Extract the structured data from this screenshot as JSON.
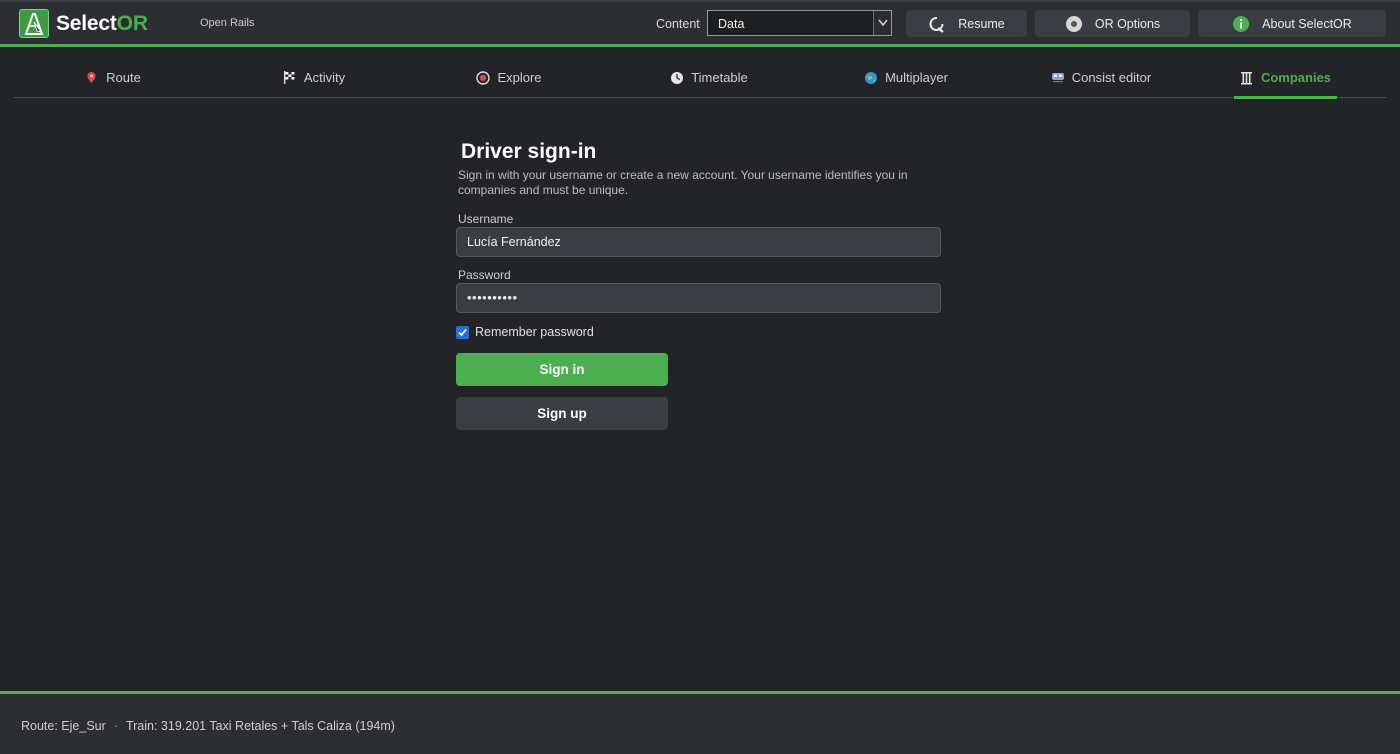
{
  "app": {
    "name_part1": "Select",
    "name_part2": "OR",
    "subtitle": "Open Rails"
  },
  "toolbar": {
    "content_label": "Content",
    "content_value": "Data",
    "resume_label": "Resume",
    "options_label": "OR Options",
    "about_label": "About SelectOR"
  },
  "tabs": [
    {
      "label": "Route",
      "icon": "map-pin-icon"
    },
    {
      "label": "Activity",
      "icon": "checkered-flag-icon"
    },
    {
      "label": "Explore",
      "icon": "explore-icon"
    },
    {
      "label": "Timetable",
      "icon": "clock-icon"
    },
    {
      "label": "Multiplayer",
      "icon": "globe-icon"
    },
    {
      "label": "Consist editor",
      "icon": "train-icon"
    },
    {
      "label": "Companies",
      "icon": "building-icon",
      "active": true
    }
  ],
  "signin": {
    "title": "Driver sign-in",
    "description": "Sign in with your username or create a new account. Your username identifies you in companies and must be unique.",
    "username_label": "Username",
    "username_value": "Lucía Fernández",
    "password_label": "Password",
    "password_mask": "••••••••••",
    "remember_label": "Remember password",
    "remember_checked": true,
    "signin_label": "Sign in",
    "signup_label": "Sign up"
  },
  "status": {
    "route": "Route: Eje_Sur",
    "separator": "·",
    "train": "Train: 319.201 Taxi Retales + Tals Caliza (194m)"
  },
  "colors": {
    "accent": "#4caf50",
    "background": "#222427",
    "panel": "#3a3d41",
    "checkbox": "#2c6fd1"
  }
}
